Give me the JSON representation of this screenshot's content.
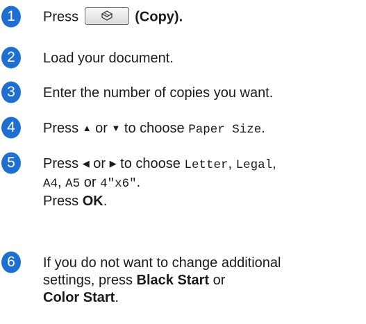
{
  "steps": [
    {
      "num": "1",
      "parts": {
        "press": "Press",
        "copy_label": "(Copy)."
      }
    },
    {
      "num": "2",
      "text": "Load your document."
    },
    {
      "num": "3",
      "text": "Enter the number of copies you want."
    },
    {
      "num": "4",
      "parts": {
        "press": "Press",
        "or": "or",
        "to_choose": "to choose",
        "option": "Paper Size",
        "end": "."
      }
    },
    {
      "num": "5",
      "parts": {
        "press": "Press",
        "or": "or",
        "to_choose": "to choose",
        "opt1": "Letter",
        "comma1": ",",
        "opt2": "Legal",
        "comma2": ",",
        "opt3": "A4",
        "comma3": ",",
        "opt4": "A5",
        "or2": "or",
        "opt5": "4\"x6\"",
        "dot": ".",
        "press2": "Press",
        "ok": "OK",
        "dot2": "."
      }
    },
    {
      "num": "6",
      "parts": {
        "line1": "If you do not want to change additional",
        "line2a": "settings, press",
        "black_start": "Black Start",
        "or": "or",
        "color_start": "Color Start",
        "dot": "."
      }
    }
  ],
  "colors": {
    "bullet": "#1e6fd0",
    "text": "#1a1a1a"
  },
  "icons": {
    "copy_key": "copy-icon",
    "up": "up-arrow-icon",
    "down": "down-arrow-icon",
    "left": "left-arrow-icon",
    "right": "right-arrow-icon"
  }
}
